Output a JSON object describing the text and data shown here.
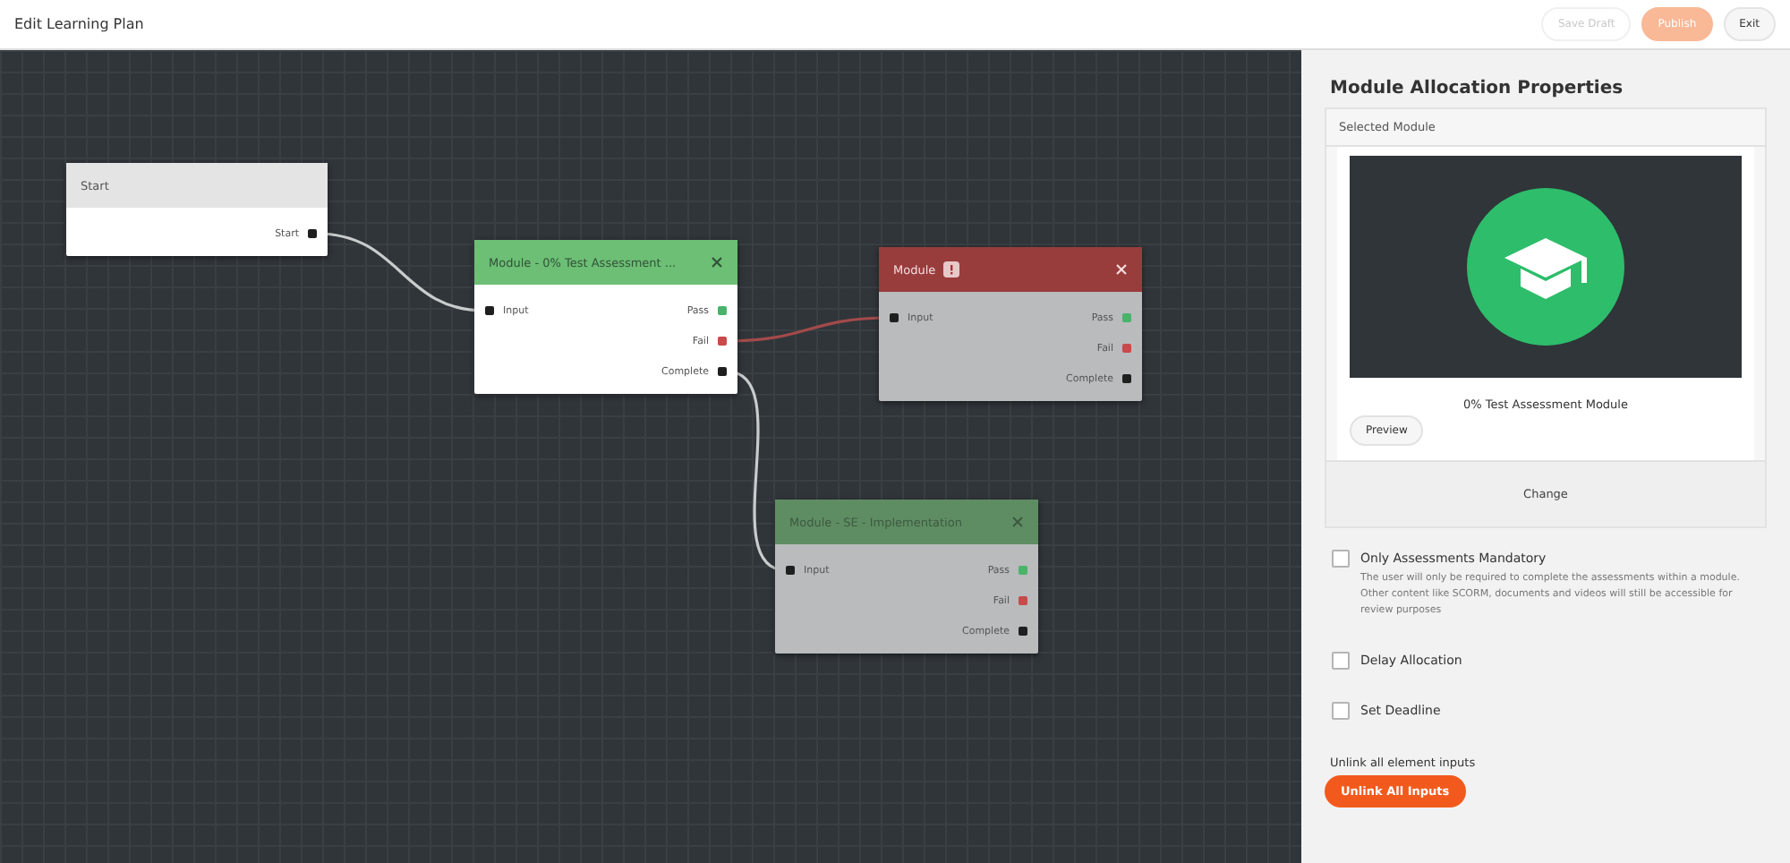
{
  "header": {
    "title": "Edit Learning Plan",
    "buttons": [
      {
        "label": "Save Draft",
        "kind": "plain",
        "disabled": true
      },
      {
        "label": "Publish",
        "kind": "primary",
        "disabled": true
      },
      {
        "label": "Exit",
        "kind": "plain",
        "disabled": false
      }
    ]
  },
  "canvas": {
    "nodes": [
      {
        "title": "Start",
        "kind": "start",
        "selected": true,
        "closable": false,
        "warning": false,
        "outputs": [
          {
            "label": "Start",
            "kind": "neutral"
          }
        ]
      },
      {
        "title": "Module - 0% Test Assessment ...",
        "kind": "valid",
        "selected": true,
        "closable": true,
        "warning": false,
        "inputs": [
          {
            "label": "Input"
          }
        ],
        "outputs": [
          {
            "label": "Pass",
            "kind": "pass"
          },
          {
            "label": "Fail",
            "kind": "fail"
          },
          {
            "label": "Complete",
            "kind": "neutral"
          }
        ]
      },
      {
        "title": "Module",
        "kind": "error",
        "selected": false,
        "closable": true,
        "warning": true,
        "inputs": [
          {
            "label": "Input"
          }
        ],
        "outputs": [
          {
            "label": "Pass",
            "kind": "pass"
          },
          {
            "label": "Fail",
            "kind": "fail"
          },
          {
            "label": "Complete",
            "kind": "neutral"
          }
        ]
      },
      {
        "title": "Module - SE - Implementation",
        "kind": "valid",
        "selected": false,
        "closable": true,
        "warning": false,
        "inputs": [
          {
            "label": "Input"
          }
        ],
        "outputs": [
          {
            "label": "Pass",
            "kind": "pass"
          },
          {
            "label": "Fail",
            "kind": "fail"
          },
          {
            "label": "Complete",
            "kind": "neutral"
          }
        ]
      }
    ]
  },
  "panel": {
    "title": "Module Allocation Properties",
    "selected_module": {
      "header": "Selected Module",
      "name": "0% Test Assessment Module",
      "preview_button": "Preview",
      "change_button": "Change"
    },
    "options": [
      {
        "label": "Only Assessments Mandatory",
        "checked": false,
        "description": "The user will only be required to complete the assessments within a module. Other content like SCORM, documents and videos will still be accessible for review purposes"
      },
      {
        "label": "Delay Allocation",
        "checked": false
      },
      {
        "label": "Set Deadline",
        "checked": false
      }
    ],
    "unlink": {
      "label": "Unlink all element inputs",
      "button": "Unlink All Inputs"
    }
  }
}
